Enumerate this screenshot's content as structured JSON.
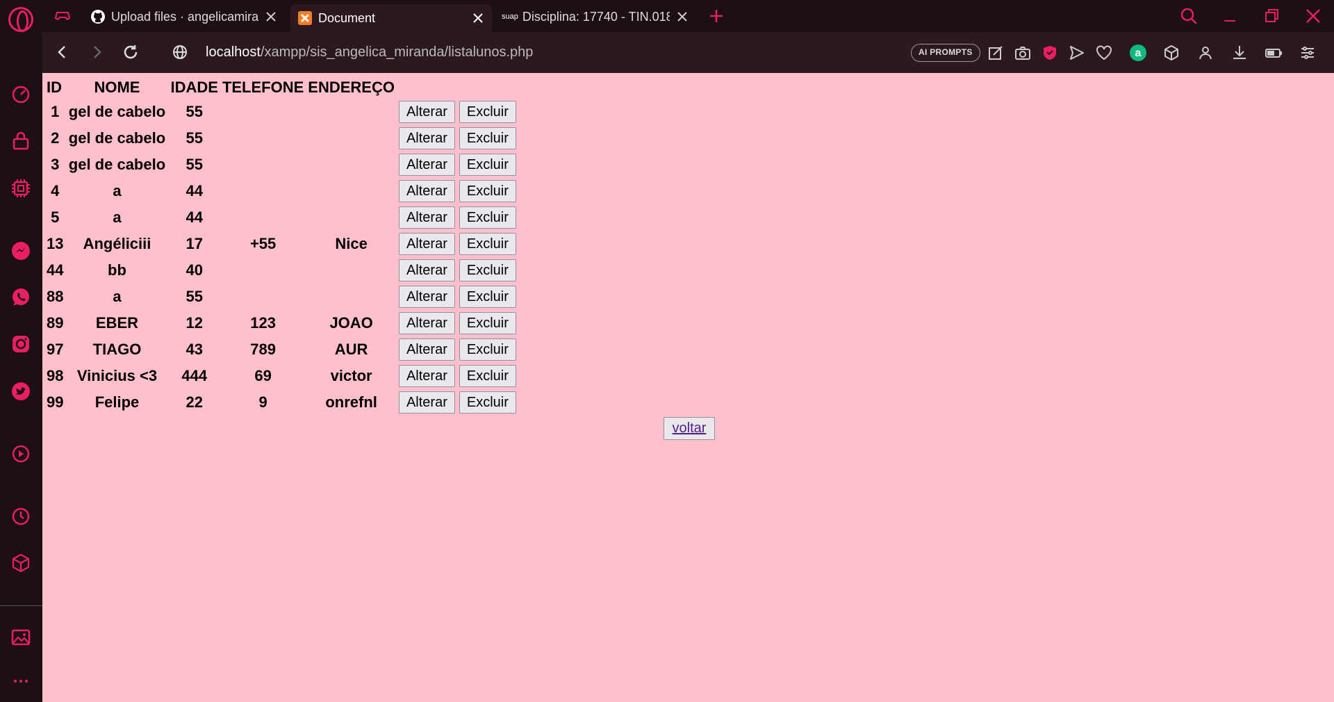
{
  "browser": {
    "accent_color": "#e91e63",
    "tabs": [
      {
        "title": "Upload files · angelicamiranda",
        "favicon": "github-icon"
      },
      {
        "title": "Document",
        "favicon": "xampp-icon",
        "active": true
      },
      {
        "title": "Disciplina: 17740 - TIN.0184",
        "favicon": "suap-icon",
        "favicon_text": "suap"
      }
    ],
    "address": {
      "host": "localhost",
      "path": "/xampp/sis_angelica_miranda/listalunos.php"
    },
    "ai_prompts_label": "AI PROMPTS"
  },
  "page": {
    "background": "#ffc0cb",
    "table": {
      "headers": [
        "ID",
        "NOME",
        "IDADE",
        "TELEFONE",
        "ENDEREÇO"
      ],
      "rows": [
        {
          "id": "1",
          "nome": "gel de cabelo",
          "idade": "55",
          "telefone": "",
          "endereco": ""
        },
        {
          "id": "2",
          "nome": "gel de cabelo",
          "idade": "55",
          "telefone": "",
          "endereco": ""
        },
        {
          "id": "3",
          "nome": "gel de cabelo",
          "idade": "55",
          "telefone": "",
          "endereco": ""
        },
        {
          "id": "4",
          "nome": "a",
          "idade": "44",
          "telefone": "",
          "endereco": ""
        },
        {
          "id": "5",
          "nome": "a",
          "idade": "44",
          "telefone": "",
          "endereco": ""
        },
        {
          "id": "13",
          "nome": "Angéliciii",
          "idade": "17",
          "telefone": "+55",
          "endereco": "Nice"
        },
        {
          "id": "44",
          "nome": "bb",
          "idade": "40",
          "telefone": "",
          "endereco": ""
        },
        {
          "id": "88",
          "nome": "a",
          "idade": "55",
          "telefone": "",
          "endereco": ""
        },
        {
          "id": "89",
          "nome": "EBER",
          "idade": "12",
          "telefone": "123",
          "endereco": "JOAO"
        },
        {
          "id": "97",
          "nome": "TIAGO",
          "idade": "43",
          "telefone": "789",
          "endereco": "AUR"
        },
        {
          "id": "98",
          "nome": "Vinicius <3",
          "idade": "444",
          "telefone": "69",
          "endereco": "victor"
        },
        {
          "id": "99",
          "nome": "Felipe",
          "idade": "22",
          "telefone": "9",
          "endereco": "onrefnl"
        }
      ],
      "edit_label": "Alterar",
      "delete_label": "Excluir"
    },
    "back_label": "voltar"
  }
}
